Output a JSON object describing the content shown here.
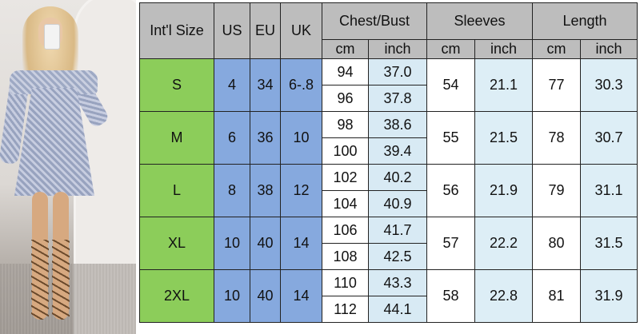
{
  "table": {
    "headers": {
      "intl_size": "Int'l Size",
      "us": "US",
      "eu": "EU",
      "uk": "UK",
      "chest": "Chest/Bust",
      "sleeves": "Sleeves",
      "length": "Length"
    },
    "units": [
      "cm",
      "inch",
      "cm",
      "inch",
      "cm",
      "inch"
    ],
    "rows": [
      {
        "size": "S",
        "us": "4",
        "eu": "34",
        "uk": "6-.8",
        "chest_cm": [
          "94",
          "96"
        ],
        "chest_inch": [
          "37.0",
          "37.8"
        ],
        "sleeve_cm": "54",
        "sleeve_inch": "21.1",
        "length_cm": "77",
        "length_inch": "30.3"
      },
      {
        "size": "M",
        "us": "6",
        "eu": "36",
        "uk": "10",
        "chest_cm": [
          "98",
          "100"
        ],
        "chest_inch": [
          "38.6",
          "39.4"
        ],
        "sleeve_cm": "55",
        "sleeve_inch": "21.5",
        "length_cm": "78",
        "length_inch": "30.7"
      },
      {
        "size": "L",
        "us": "8",
        "eu": "38",
        "uk": "12",
        "chest_cm": [
          "102",
          "104"
        ],
        "chest_inch": [
          "40.2",
          "40.9"
        ],
        "sleeve_cm": "56",
        "sleeve_inch": "21.9",
        "length_cm": "79",
        "length_inch": "31.1"
      },
      {
        "size": "XL",
        "us": "10",
        "eu": "40",
        "uk": "14",
        "chest_cm": [
          "106",
          "108"
        ],
        "chest_inch": [
          "41.7",
          "42.5"
        ],
        "sleeve_cm": "57",
        "sleeve_inch": "22.2",
        "length_cm": "80",
        "length_inch": "31.5"
      },
      {
        "size": "2XL",
        "us": "10",
        "eu": "40",
        "uk": "14",
        "chest_cm": [
          "110",
          "112"
        ],
        "chest_inch": [
          "43.3",
          "44.1"
        ],
        "sleeve_cm": "58",
        "sleeve_inch": "22.8",
        "length_cm": "81",
        "length_inch": "31.9"
      }
    ]
  },
  "colors": {
    "size_column": "#8ccd5a",
    "us_eu_uk_columns": "#86a9de",
    "header_background": "#bdbdbd",
    "inch_column": "#d8eaf4"
  }
}
